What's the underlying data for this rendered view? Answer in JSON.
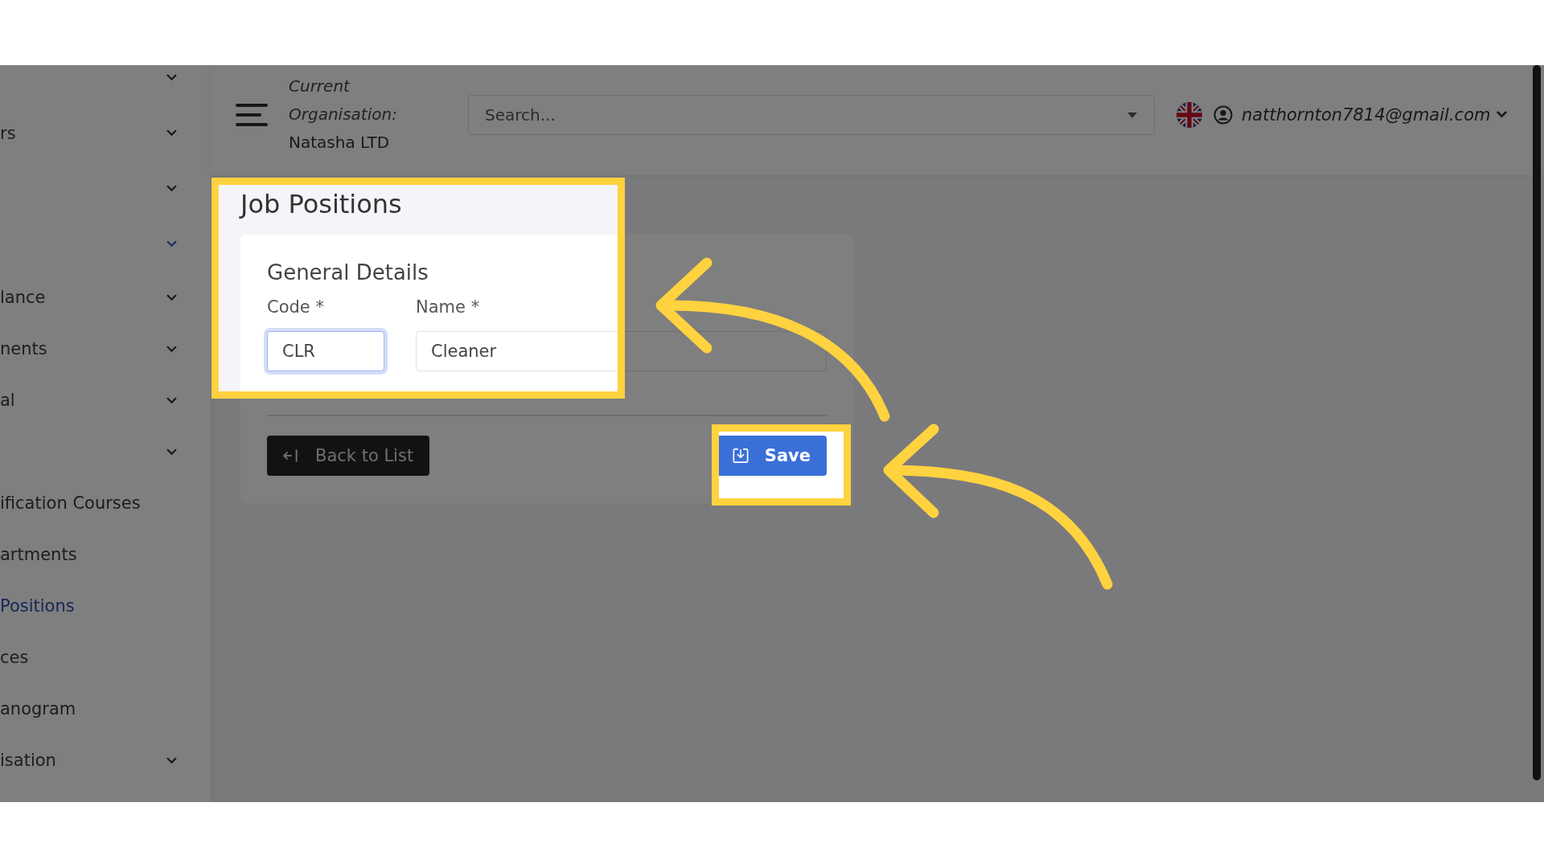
{
  "sidebar": {
    "items": [
      {
        "kind": "group",
        "active": false
      },
      {
        "kind": "group",
        "label": "rs",
        "active": false
      },
      {
        "kind": "group",
        "active": false
      },
      {
        "kind": "group",
        "active": true
      },
      {
        "kind": "group",
        "label": "lance",
        "active": false
      },
      {
        "kind": "group",
        "label": "nents",
        "active": false
      },
      {
        "kind": "group",
        "label": "al",
        "active": false
      },
      {
        "kind": "group",
        "active": false
      },
      {
        "kind": "link",
        "label": "ification Courses",
        "selected": false
      },
      {
        "kind": "link",
        "label": "artments",
        "selected": false
      },
      {
        "kind": "link",
        "label": "Positions",
        "selected": true
      },
      {
        "kind": "link",
        "label": "ces",
        "selected": false
      },
      {
        "kind": "link",
        "label": "anogram",
        "selected": false
      },
      {
        "kind": "group",
        "label": "isation",
        "active": false
      }
    ]
  },
  "header": {
    "organisation_label": "Current Organisation:",
    "organisation_name": "Natasha LTD",
    "search": {
      "placeholder": "Search..."
    },
    "user_email": "natthornton7814@gmail.com"
  },
  "page_title": "Job Positions",
  "card": {
    "title": "General Details",
    "fields": [
      {
        "label": "Code *",
        "value": "CLR",
        "focused": true
      },
      {
        "label": "Name *",
        "value": "Cleaner",
        "focused": false
      }
    ],
    "buttons": [
      {
        "kind": "back",
        "label": "Back to List"
      },
      {
        "kind": "save",
        "label": "Save"
      }
    ]
  }
}
